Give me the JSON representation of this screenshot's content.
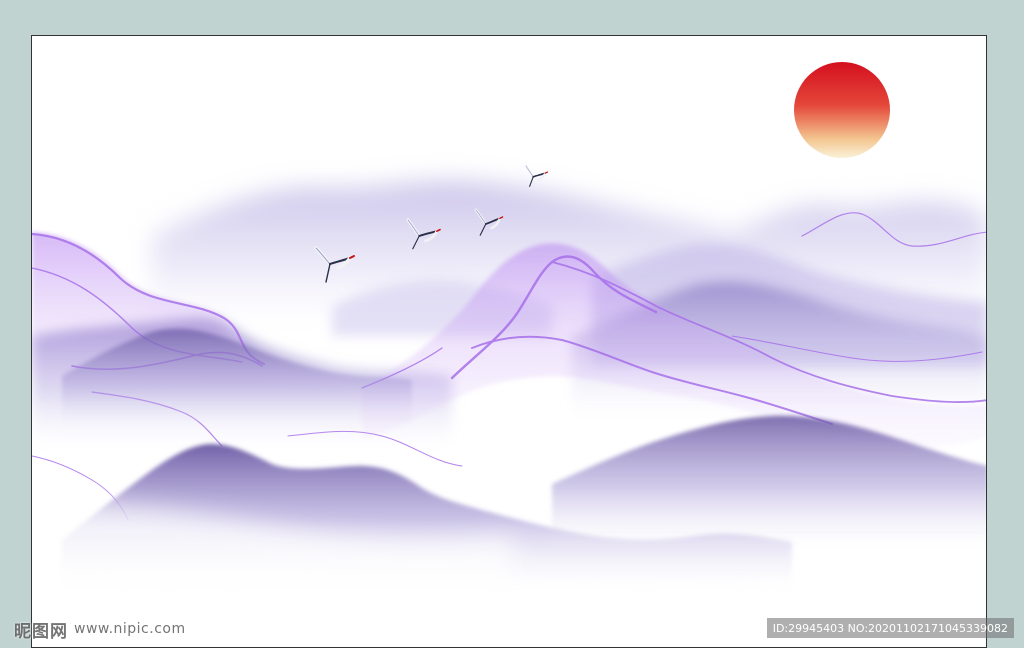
{
  "watermark": {
    "brand_cn": "昵图网",
    "brand_url": "www.nipic.com",
    "id_text": "ID:29945403 NO:20201102171045339082"
  },
  "colors": {
    "frame": "#c1d3d1",
    "sun_top": "#d40f1e",
    "sun_bottom": "#f7e8b8",
    "mist_purple": "#8a78c8",
    "ink_purple": "#6a5aa8",
    "vein_violet": "#a46ee8"
  },
  "icons": {
    "birds": "crane-icon"
  }
}
